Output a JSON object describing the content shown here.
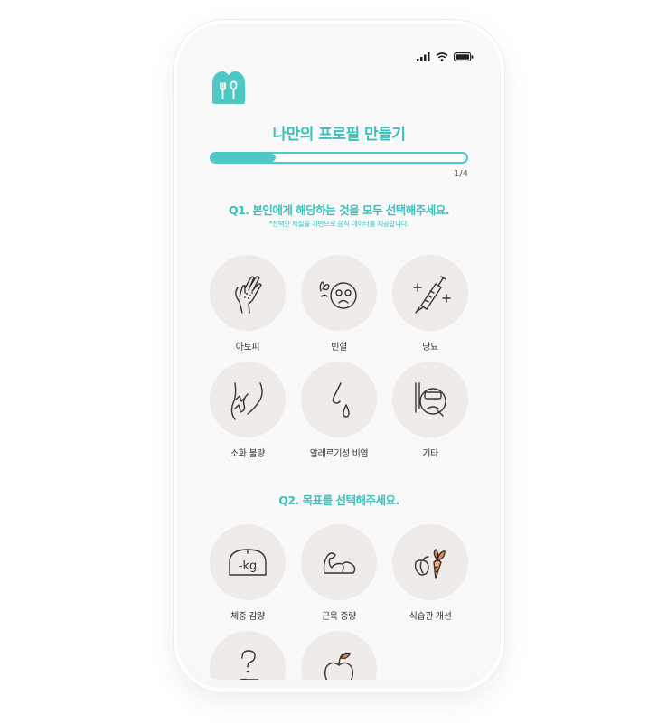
{
  "header": {
    "title": "나만의 프로필 만들기"
  },
  "progress": {
    "value": 0.25,
    "step_text": "1/4"
  },
  "q1": {
    "title": "Q1. 본인에게 해당하는 것을 모두 선택해주세요.",
    "note": "*선택한 체질을 기반으로 음식 데이터를 제공합니다.",
    "options": [
      {
        "label": "아토피",
        "icon": "hand-rash-icon"
      },
      {
        "label": "빈혈",
        "icon": "dizzy-face-icon"
      },
      {
        "label": "당뇨",
        "icon": "syringe-icon"
      },
      {
        "label": "소화 불량",
        "icon": "stomach-ache-icon"
      },
      {
        "label": "알레르기성 비염",
        "icon": "runny-nose-icon"
      },
      {
        "label": "기타",
        "icon": "sick-face-icon"
      }
    ]
  },
  "q2": {
    "title": "Q2. 목표를 선택해주세요.",
    "options": [
      {
        "label": "체중 감량",
        "icon": "scale-kg-icon",
        "icon_text": "-kg"
      },
      {
        "label": "근육 증량",
        "icon": "muscle-arm-icon"
      },
      {
        "label": "식습관 개선",
        "icon": "vegetables-icon"
      },
      {
        "label": "",
        "icon": "question-hand-icon"
      },
      {
        "label": "",
        "icon": "apple-icon"
      }
    ]
  },
  "colors": {
    "accent": "#3dbfbc",
    "circle": "#efebe8",
    "icon_stroke": "#3b322e"
  }
}
